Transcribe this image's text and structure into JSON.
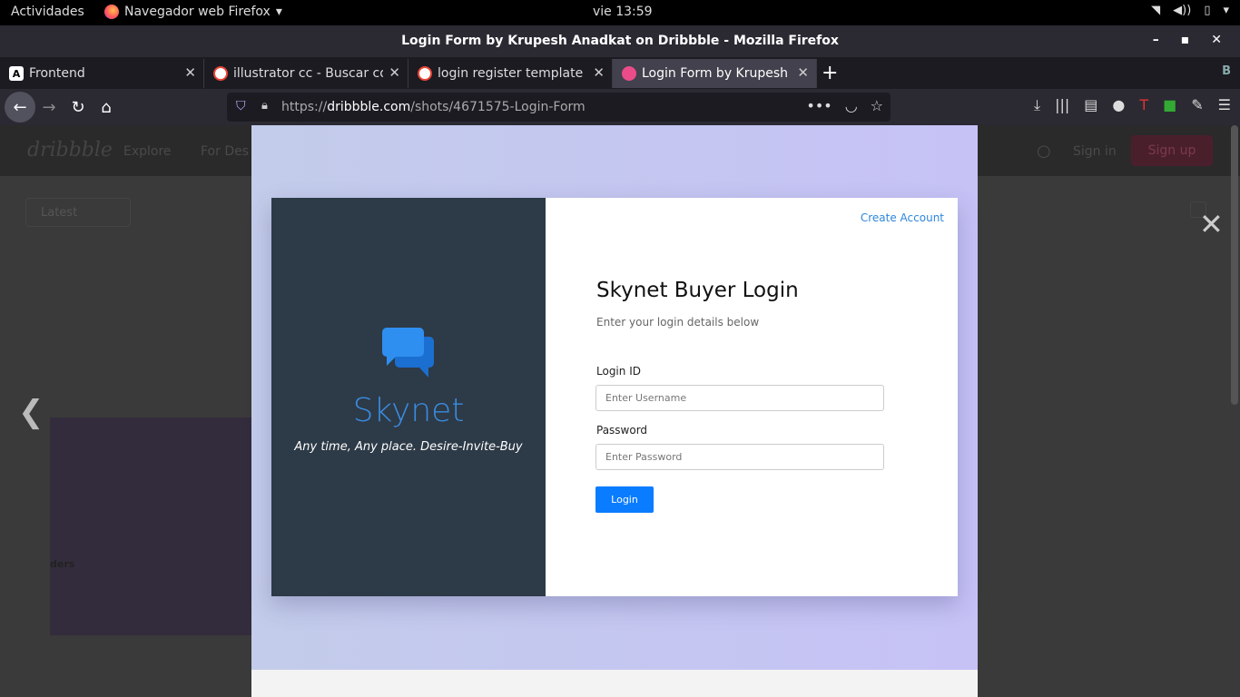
{
  "topbar": {
    "activities": "Actividades",
    "app_name": "Navegador web Firefox",
    "clock": "vie 13:59"
  },
  "window": {
    "title": "Login Form by Krupesh Anadkat on Dribbble - Mozilla Firefox"
  },
  "tabs": [
    {
      "label": "Frontend",
      "icon": "a-icon"
    },
    {
      "label": "illustrator cc - Buscar con",
      "icon": "google-icon"
    },
    {
      "label": "login register template -",
      "icon": "google-icon"
    },
    {
      "label": "Login Form by Krupesh A",
      "icon": "dribbble-icon",
      "active": true
    }
  ],
  "urlbar": {
    "url_prefix": "https://",
    "url_domain": "dribbble.com",
    "url_path": "/shots/4671575-Login-Form"
  },
  "dribbble": {
    "nav_explore": "Explore",
    "nav_designers": "For Des",
    "sign_in": "Sign in",
    "sign_up": "Sign up",
    "filter": "Latest",
    "thumb_text": "ders"
  },
  "shot": {
    "create_account": "Create Account",
    "brand_name": "Skynet",
    "tagline": "Any time, Any place. Desire-Invite-Buy",
    "form_title": "Skynet Buyer Login",
    "form_subtitle": "Enter your login details below",
    "login_id_label": "Login ID",
    "username_placeholder": "Enter Username",
    "password_label": "Password",
    "password_placeholder": "Enter Password",
    "login_button": "Login",
    "brand_color": "#3a8be0",
    "panel_color": "#2d3a47",
    "button_color": "#0a7cff"
  }
}
